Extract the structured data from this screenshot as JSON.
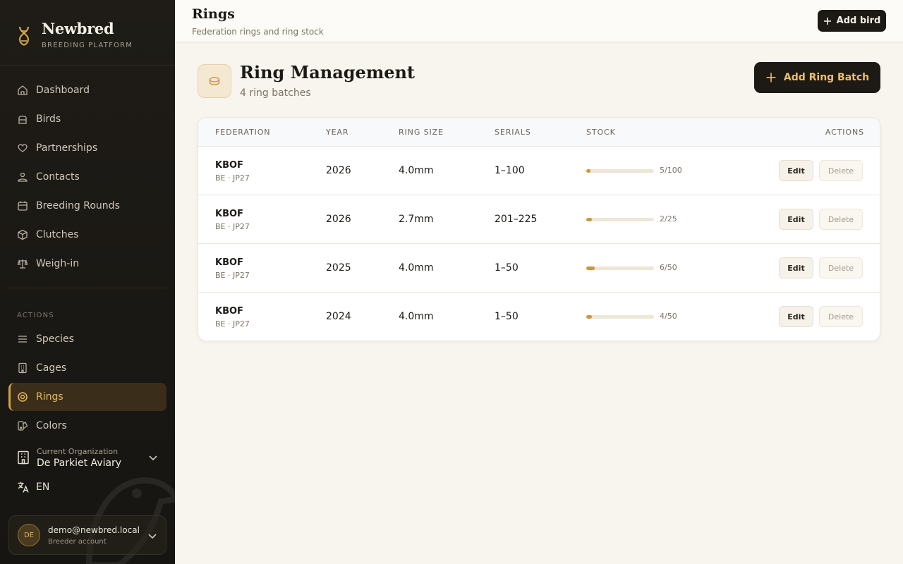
{
  "brand": {
    "name": "Newbred",
    "subtitle": "BREEDING PLATFORM",
    "accent": "#d4a240"
  },
  "sidebar": {
    "items": [
      {
        "label": "Dashboard",
        "icon": "home-icon"
      },
      {
        "label": "Birds",
        "icon": "birds-icon"
      },
      {
        "label": "Partnerships",
        "icon": "heart-icon"
      },
      {
        "label": "Contacts",
        "icon": "contacts-icon"
      },
      {
        "label": "Breeding Rounds",
        "icon": "calendar-icon"
      },
      {
        "label": "Clutches",
        "icon": "box-icon"
      },
      {
        "label": "Weigh-in",
        "icon": "scale-icon"
      }
    ],
    "section_label": "ACTIONS",
    "action_items": [
      {
        "label": "Species",
        "icon": "list-icon"
      },
      {
        "label": "Cages",
        "icon": "building-icon"
      },
      {
        "label": "Rings",
        "icon": "ring-icon",
        "active": true
      },
      {
        "label": "Colors",
        "icon": "palette-icon"
      }
    ],
    "org": {
      "label": "Current Organization",
      "name": "De Parkiet Aviary"
    },
    "language": "EN",
    "user": {
      "initials": "DE",
      "email": "demo@newbred.local",
      "role": "Breeder account"
    }
  },
  "header": {
    "title": "Rings",
    "subtitle": "Federation rings and ring stock",
    "add_bird_label": "Add bird"
  },
  "main": {
    "title": "Ring Management",
    "count_text": "4 ring batches",
    "add_batch_label": "Add Ring Batch",
    "columns": [
      "FEDERATION",
      "YEAR",
      "RING SIZE",
      "SERIALS",
      "STOCK",
      "ACTIONS"
    ],
    "rows": [
      {
        "federation": "KBOF",
        "sub": "BE · JP27",
        "year": "2026",
        "size": "4.0mm",
        "serials": "1–100",
        "stock": "5/100",
        "fraction": 0.05
      },
      {
        "federation": "KBOF",
        "sub": "BE · JP27",
        "year": "2026",
        "size": "2.7mm",
        "serials": "201–225",
        "stock": "2/25",
        "fraction": 0.08
      },
      {
        "federation": "KBOF",
        "sub": "BE · JP27",
        "year": "2025",
        "size": "4.0mm",
        "serials": "1–50",
        "stock": "6/50",
        "fraction": 0.12
      },
      {
        "federation": "KBOF",
        "sub": "BE · JP27",
        "year": "2024",
        "size": "4.0mm",
        "serials": "1–50",
        "stock": "4/50",
        "fraction": 0.08
      }
    ],
    "edit_label": "Edit",
    "delete_label": "Delete"
  }
}
